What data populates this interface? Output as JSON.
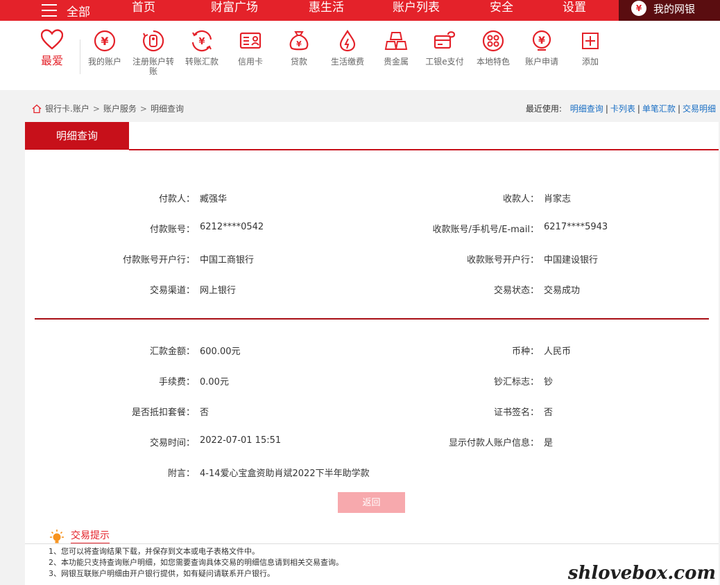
{
  "topnav": {
    "all_label": "全部",
    "items": [
      "首页",
      "财富广场",
      "惠生活",
      "账户列表",
      "安全",
      "设置"
    ],
    "mybank_label": "我的网银",
    "mybank_badge": "¥"
  },
  "iconbar": {
    "favorite_label": "最爱",
    "items": [
      {
        "label": "我的账户",
        "icon": "yuan-circle-icon"
      },
      {
        "label": "注册账户转账",
        "icon": "register-transfer-icon"
      },
      {
        "label": "转账汇款",
        "icon": "transfer-icon"
      },
      {
        "label": "信用卡",
        "icon": "credit-card-icon"
      },
      {
        "label": "贷款",
        "icon": "loan-bag-icon"
      },
      {
        "label": "生活缴费",
        "icon": "droplet-icon"
      },
      {
        "label": "贵金属",
        "icon": "gold-bars-icon"
      },
      {
        "label": "工银e支付",
        "icon": "epay-icon"
      },
      {
        "label": "本地特色",
        "icon": "local-feature-icon"
      },
      {
        "label": "账户申请",
        "icon": "account-apply-icon"
      },
      {
        "label": "添加",
        "icon": "plus-square-icon"
      }
    ],
    "accent": "#e4222a"
  },
  "breadcrumb": [
    "银行卡.账户",
    "账户服务",
    "明细查询"
  ],
  "recent": {
    "label": "最近使用:",
    "links": [
      "明细查询",
      "卡列表",
      "单笔汇款",
      "交易明细"
    ]
  },
  "panel": {
    "tab_label": "明细查询",
    "left": [
      {
        "k": "付款人：",
        "v": "臧强华"
      },
      {
        "k": "付款账号：",
        "v": "6212****0542"
      },
      {
        "k": "付款账号开户行：",
        "v": "中国工商银行"
      },
      {
        "k": "交易渠道：",
        "v": "网上银行"
      }
    ],
    "right": [
      {
        "k": "收款人：",
        "v": "肖家志"
      },
      {
        "k": "收款账号/手机号/E-mail：",
        "v": "6217****5943"
      },
      {
        "k": "收款账号开户行：",
        "v": "中国建设银行"
      },
      {
        "k": "交易状态：",
        "v": "交易成功"
      }
    ],
    "left2": [
      {
        "k": "汇款金额：",
        "v": "600.00元"
      },
      {
        "k": "手续费：",
        "v": "0.00元"
      },
      {
        "k": "是否抵扣套餐：",
        "v": "否"
      },
      {
        "k": "交易时间：",
        "v": "2022-07-01 15:51"
      },
      {
        "k": "附言：",
        "v": "4-14爱心宝盒资助肖斌2022下半年助学款"
      }
    ],
    "right2": [
      {
        "k": "币种：",
        "v": "人民币"
      },
      {
        "k": "钞汇标志：",
        "v": "钞"
      },
      {
        "k": "证书签名：",
        "v": "否"
      },
      {
        "k": "显示付款人账户信息：",
        "v": "是"
      }
    ],
    "back_label": "返回"
  },
  "tips": {
    "title": "交易提示",
    "lines": [
      "1、您可以将查询结果下载，并保存到文本或电子表格文件中。",
      "2、本功能只支持查询账户明细，如您需要查询具体交易的明细信息请到相关交易查询。",
      "3、网银互联账户明细由开户银行提供，如有疑问请联系开户银行。"
    ]
  },
  "watermark": "shlovebox.com"
}
